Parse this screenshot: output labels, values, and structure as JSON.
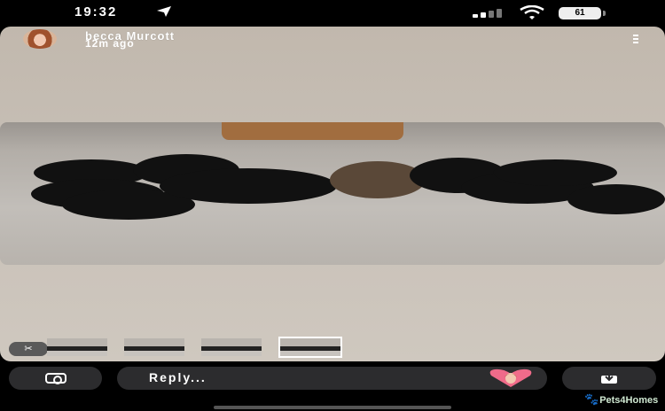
{
  "status_bar": {
    "time": "19:32",
    "battery": "61",
    "icons": [
      "location-arrow-icon",
      "signal-icon",
      "wifi-icon",
      "battery-icon"
    ]
  },
  "story": {
    "user_name": "becca Murcott",
    "posted": "12m ago",
    "more_icon": "more-vertical-icon"
  },
  "thumbnails": {
    "count": 4,
    "selected_index": 3,
    "edit_icon": "scissors-icon"
  },
  "reply_bar": {
    "camera_icon": "camera-icon",
    "placeholder": "Reply...",
    "reaction_icon": "heart-avatar-icon",
    "share_icon": "share-icon"
  },
  "watermark": {
    "text": "Pets4Homes"
  },
  "colors": {
    "background": "#000000",
    "card": "#c7bfb6",
    "control": "#2c2c2e",
    "heart": "#f06b8a"
  }
}
